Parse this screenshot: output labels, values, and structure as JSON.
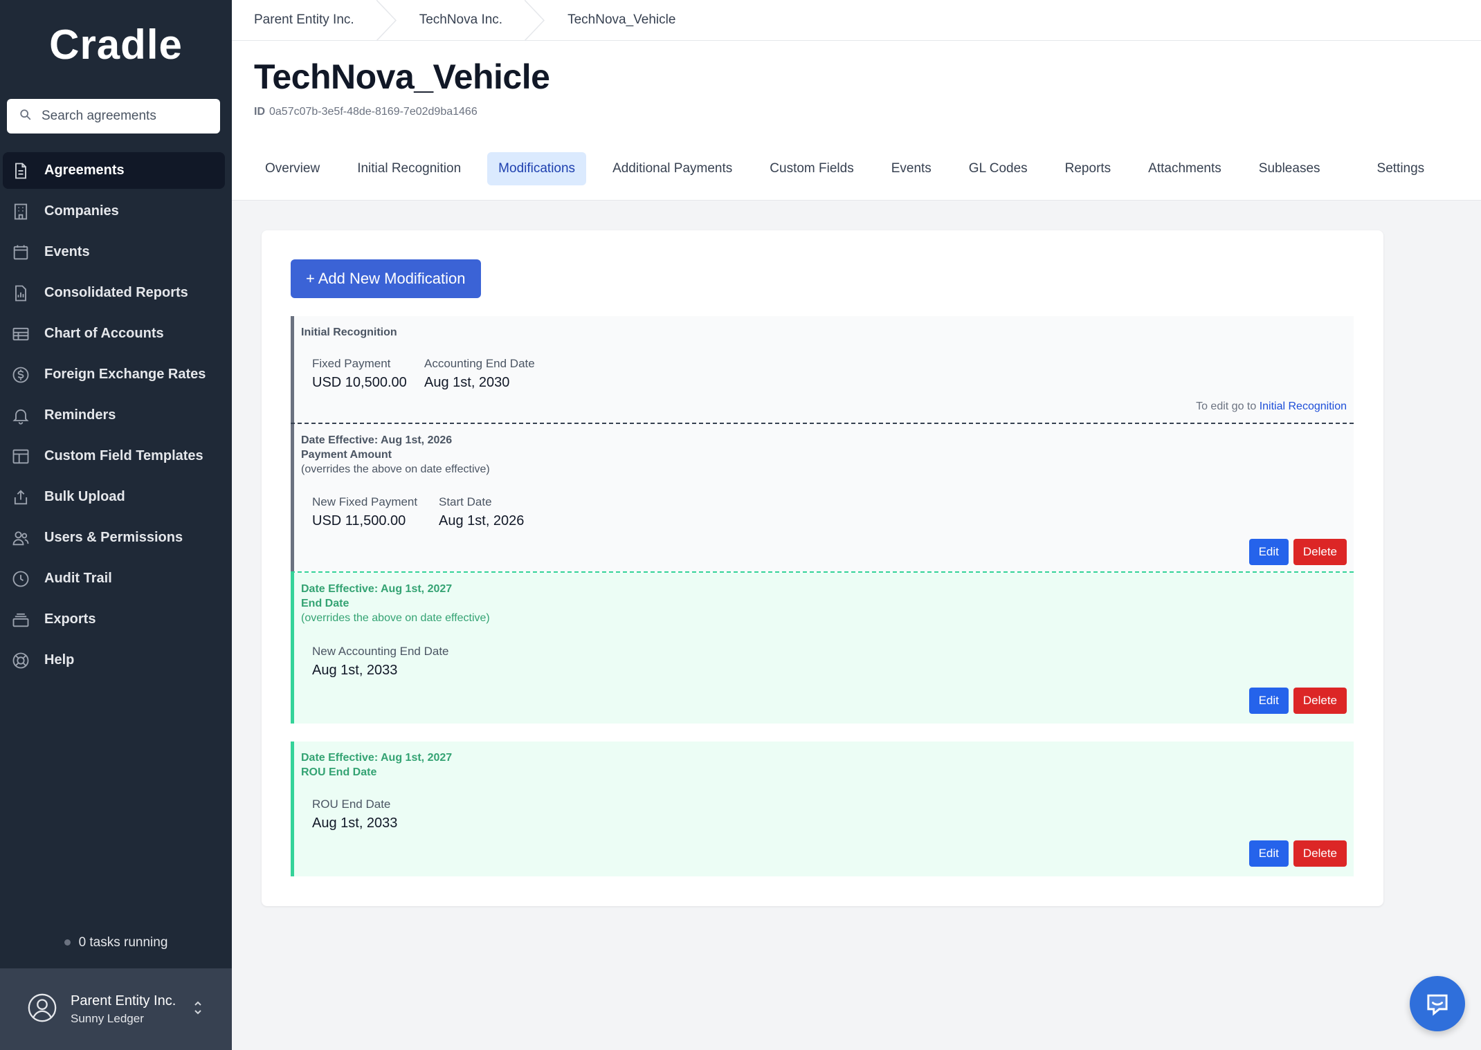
{
  "app": {
    "logo": "Cradle"
  },
  "search": {
    "placeholder": "Search agreements"
  },
  "sidebar": {
    "items": [
      {
        "label": "Agreements",
        "icon": "document-icon",
        "active": true
      },
      {
        "label": "Companies",
        "icon": "building-icon"
      },
      {
        "label": "Events",
        "icon": "calendar-icon"
      },
      {
        "label": "Consolidated Reports",
        "icon": "report-icon"
      },
      {
        "label": "Chart of Accounts",
        "icon": "table-icon"
      },
      {
        "label": "Foreign Exchange Rates",
        "icon": "dollar-circle-icon"
      },
      {
        "label": "Reminders",
        "icon": "bell-icon"
      },
      {
        "label": "Custom Field Templates",
        "icon": "template-icon"
      },
      {
        "label": "Bulk Upload",
        "icon": "upload-icon"
      },
      {
        "label": "Users & Permissions",
        "icon": "users-icon"
      },
      {
        "label": "Audit Trail",
        "icon": "clock-icon"
      },
      {
        "label": "Exports",
        "icon": "stack-icon"
      },
      {
        "label": "Help",
        "icon": "lifebuoy-icon"
      }
    ],
    "tasks": "0 tasks running",
    "user": {
      "org": "Parent Entity Inc.",
      "name": "Sunny Ledger"
    }
  },
  "breadcrumb": [
    "Parent Entity Inc.",
    "TechNova Inc.",
    "TechNova_Vehicle"
  ],
  "page": {
    "title": "TechNova_Vehicle",
    "id_label": "ID",
    "id": "0a57c07b-3e5f-48de-8169-7e02d9ba1466"
  },
  "tabs": [
    {
      "label": "Overview"
    },
    {
      "label": "Initial Recognition"
    },
    {
      "label": "Modifications",
      "active": true
    },
    {
      "label": "Additional Payments"
    },
    {
      "label": "Custom Fields"
    },
    {
      "label": "Events"
    },
    {
      "label": "GL Codes"
    },
    {
      "label": "Reports"
    },
    {
      "label": "Attachments"
    },
    {
      "label": "Subleases"
    },
    {
      "label": "Settings"
    }
  ],
  "content": {
    "add_button": "+ Add New Modification",
    "initial": {
      "heading": "Initial Recognition",
      "fields": [
        {
          "label": "Fixed Payment",
          "value": "USD 10,500.00"
        },
        {
          "label": "Accounting End Date",
          "value": "Aug 1st, 2030"
        }
      ],
      "note_prefix": "To edit go to",
      "note_link": "Initial Recognition"
    },
    "modifications": [
      {
        "date_effective": "Date Effective: Aug 1st, 2026",
        "type": "Payment Amount",
        "override_note": "(overrides the above on date effective)",
        "fields": [
          {
            "label": "New Fixed Payment",
            "value": "USD 11,500.00"
          },
          {
            "label": "Start Date",
            "value": "Aug 1st, 2026"
          }
        ]
      },
      {
        "date_effective": "Date Effective: Aug 1st, 2027",
        "type": "End Date",
        "override_note": "(overrides the above on date effective)",
        "fields": [
          {
            "label": "New Accounting End Date",
            "value": "Aug 1st, 2033"
          }
        ]
      },
      {
        "date_effective": "Date Effective: Aug 1st, 2027",
        "type": "ROU End Date",
        "fields": [
          {
            "label": "ROU End Date",
            "value": "Aug 1st, 2033"
          }
        ]
      }
    ],
    "edit_label": "Edit",
    "delete_label": "Delete"
  },
  "colors": {
    "sidebar_bg": "#1f2937",
    "primary": "#3b63d6",
    "danger": "#dc2626",
    "green_accent": "#34d399",
    "active_tab_bg": "#dbeafe"
  }
}
